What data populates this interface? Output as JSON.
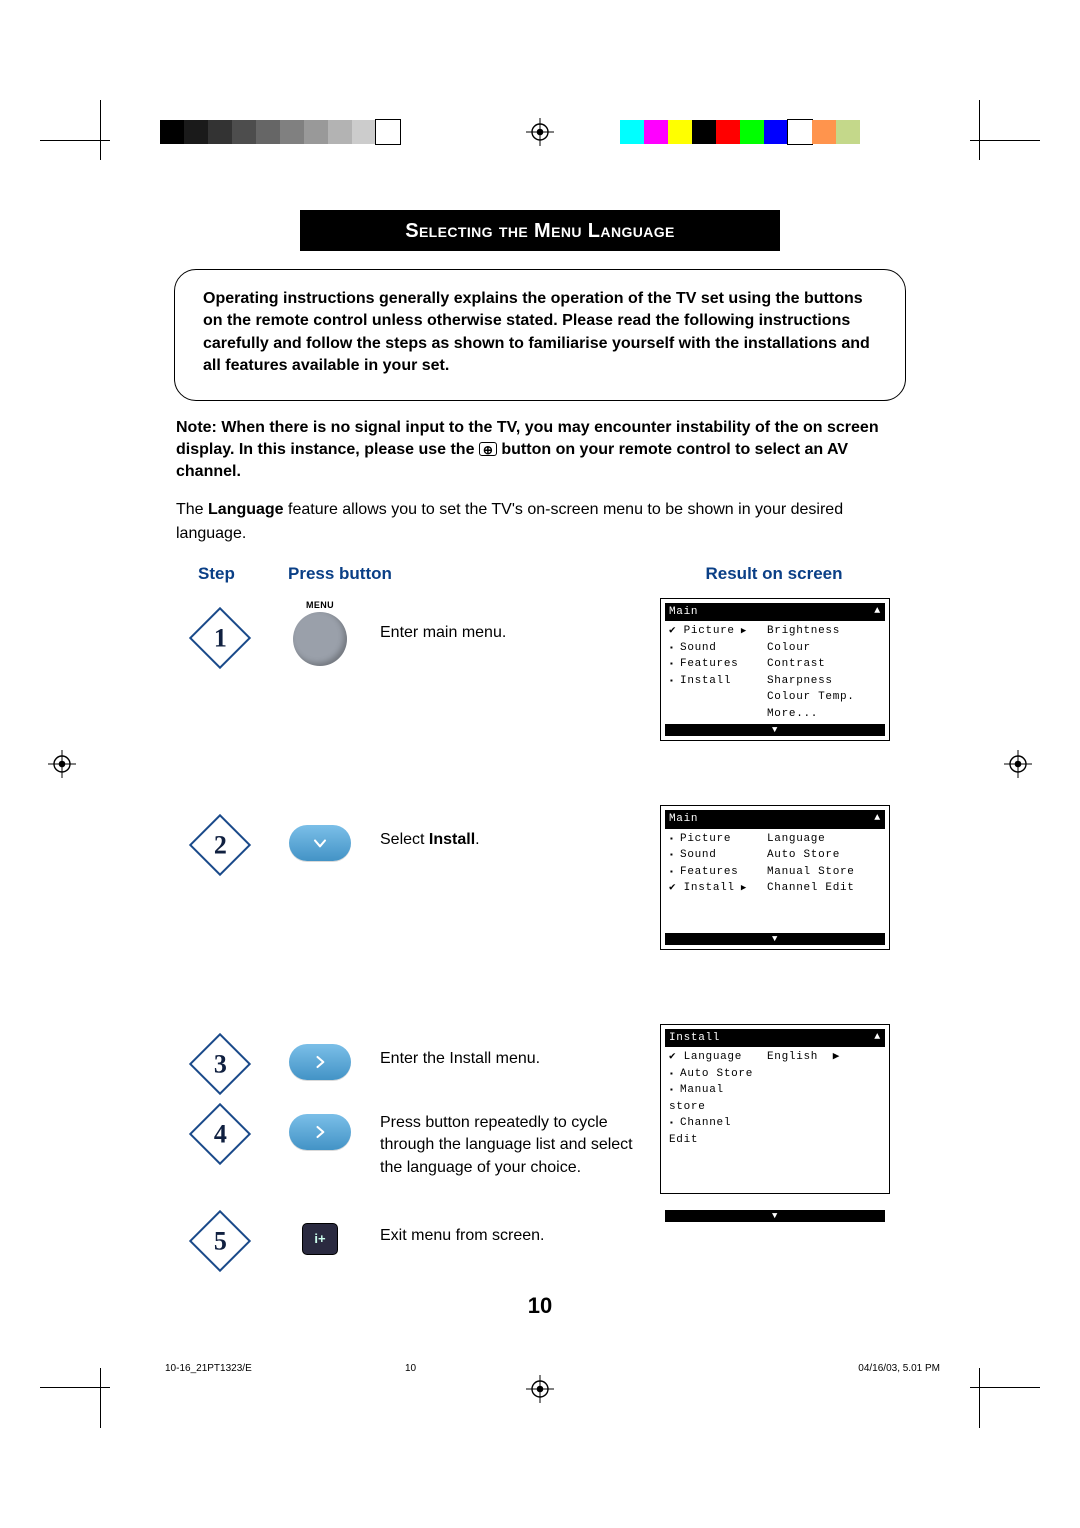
{
  "print": {
    "gray": [
      "#000000",
      "#1a1a1a",
      "#333333",
      "#4d4d4d",
      "#666666",
      "#808080",
      "#999999",
      "#b3b3b3",
      "#cccccc",
      "#ffffff"
    ],
    "color": [
      "#00ffff",
      "#ff00ff",
      "#ffff00",
      "#000000",
      "#ff0000",
      "#00ff00",
      "#0000ff",
      "#ffffff",
      "#ff944d",
      "#c4d88a"
    ]
  },
  "title": "Selecting the Menu Language",
  "intro": "Operating instructions generally explains the operation of the TV set using the buttons on the remote control unless otherwise stated. Please read the following instructions carefully and follow the steps as shown to familiarise yourself with the installations and all features available in your set.",
  "note_a": "Note: When there is no signal input to the TV, you may encounter instability of the on screen display. In this instance, please use the ",
  "note_b": " button on your remote control to select an AV channel.",
  "para_a": "The ",
  "para_key": "Language",
  "para_b": " feature allows you to set the TV's on-screen menu to be shown in your desired language.",
  "hdr": {
    "step": "Step",
    "press": "Press button",
    "result": "Result on screen"
  },
  "menu_label": "MENU",
  "steps": {
    "s1": {
      "n": "1",
      "desc": "Enter main menu."
    },
    "s2": {
      "n": "2",
      "desc_a": "Select ",
      "desc_b": "Install",
      "desc_c": "."
    },
    "s3": {
      "n": "3",
      "desc": "Enter the Install menu."
    },
    "s4": {
      "n": "4",
      "desc": "Press button repeatedly to cycle through the language list and select the language of your choice."
    },
    "s5": {
      "n": "5",
      "desc": "Exit menu from screen."
    }
  },
  "tv1": {
    "barTitle": "Main",
    "left": [
      "Picture",
      "Sound",
      "Features",
      "Install"
    ],
    "leftSel": 0,
    "right": [
      "Brightness",
      "Colour",
      "Contrast",
      "Sharpness",
      "Colour Temp.",
      "More..."
    ]
  },
  "tv2": {
    "barTitle": "Main",
    "left": [
      "Picture",
      "Sound",
      "Features",
      "Install"
    ],
    "leftSel": 3,
    "right": [
      "Language",
      "Auto Store",
      "Manual Store",
      "Channel Edit"
    ]
  },
  "tv3": {
    "barTitle": "Install",
    "left": [
      "Language",
      "Auto Store",
      "Manual store",
      "Channel Edit"
    ],
    "leftSel": 0,
    "rightVal": "English"
  },
  "pagenum": "10",
  "footer": {
    "f1": "10-16_21PT1323/E",
    "f2": "10",
    "f3": "04/16/03, 5.01 PM"
  }
}
